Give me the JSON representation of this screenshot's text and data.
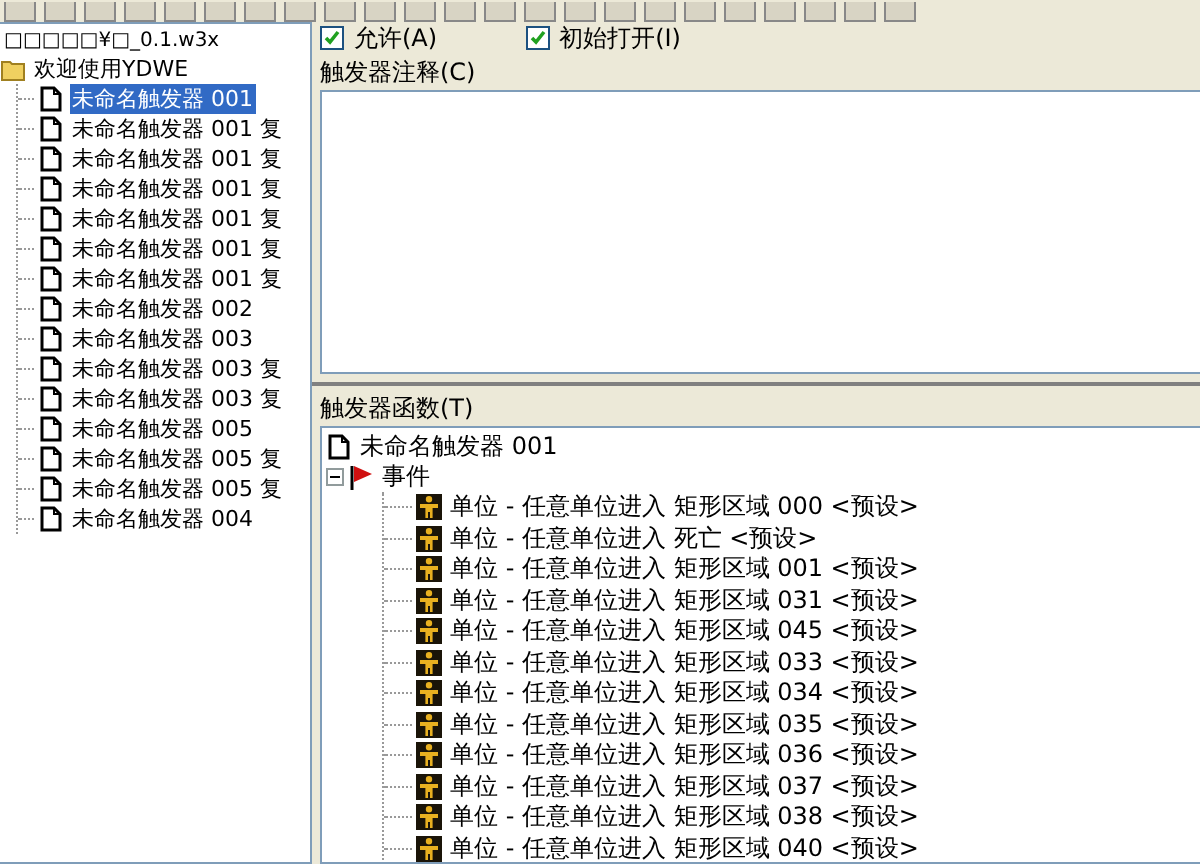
{
  "map_tree": {
    "title": "□□□□□¥□_0.1.w3x",
    "root": {
      "label": "欢迎使用YDWE",
      "children": [
        {
          "label": "未命名触发器 001",
          "selected": true
        },
        {
          "label": "未命名触发器 001 复",
          "selected": false
        },
        {
          "label": "未命名触发器 001 复",
          "selected": false
        },
        {
          "label": "未命名触发器 001 复",
          "selected": false
        },
        {
          "label": "未命名触发器 001 复",
          "selected": false
        },
        {
          "label": "未命名触发器 001 复",
          "selected": false
        },
        {
          "label": "未命名触发器 001 复",
          "selected": false
        },
        {
          "label": "未命名触发器 002",
          "selected": false
        },
        {
          "label": "未命名触发器 003",
          "selected": false
        },
        {
          "label": "未命名触发器 003 复",
          "selected": false
        },
        {
          "label": "未命名触发器 003 复",
          "selected": false
        },
        {
          "label": "未命名触发器 005",
          "selected": false
        },
        {
          "label": "未命名触发器 005 复",
          "selected": false
        },
        {
          "label": "未命名触发器 005 复",
          "selected": false
        },
        {
          "label": "未命名触发器 004",
          "selected": false
        }
      ]
    }
  },
  "options": [
    {
      "label": "允许(A)",
      "checked": true
    },
    {
      "label": "初始打开(I)",
      "checked": true
    }
  ],
  "comment": {
    "label": "触发器注释(C)"
  },
  "functions": {
    "label": "触发器函数(T)",
    "tree": {
      "label": "未命名触发器 001",
      "children": [
        {
          "label": "事件",
          "kind": "event",
          "expanded": true,
          "children": [
            {
              "label": "单位 - 任意单位进入 矩形区域 000 <预设>"
            },
            {
              "label": "单位 - 任意单位进入 死亡 <预设>"
            },
            {
              "label": "单位 - 任意单位进入 矩形区域 001 <预设>"
            },
            {
              "label": "单位 - 任意单位进入 矩形区域 031 <预设>"
            },
            {
              "label": "单位 - 任意单位进入 矩形区域 045 <预设>"
            },
            {
              "label": "单位 - 任意单位进入 矩形区域 033 <预设>"
            },
            {
              "label": "单位 - 任意单位进入 矩形区域 034 <预设>"
            },
            {
              "label": "单位 - 任意单位进入 矩形区域 035 <预设>"
            },
            {
              "label": "单位 - 任意单位进入 矩形区域 036 <预设>"
            },
            {
              "label": "单位 - 任意单位进入 矩形区域 037 <预设>"
            },
            {
              "label": "单位 - 任意单位进入 矩形区域 038 <预设>"
            },
            {
              "label": "单位 - 任意单位进入 矩形区域 040 <预设>"
            }
          ]
        }
      ]
    }
  }
}
